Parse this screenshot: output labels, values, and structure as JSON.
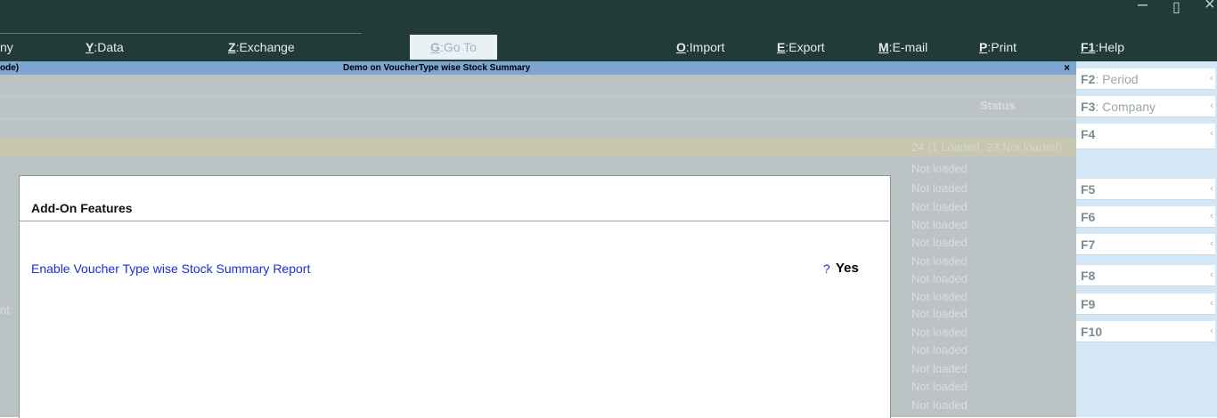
{
  "menu": {
    "items": [
      {
        "key": "",
        "label": "ny"
      },
      {
        "key": "Y",
        "label": "Data"
      },
      {
        "key": "Z",
        "label": "Exchange"
      },
      {
        "key": "G",
        "label": "Go To"
      },
      {
        "key": "O",
        "label": "Import"
      },
      {
        "key": "E",
        "label": "Export"
      },
      {
        "key": "M",
        "label": "E-mail"
      },
      {
        "key": "P",
        "label": "Print"
      },
      {
        "key": "F1",
        "label": "Help"
      }
    ]
  },
  "window": {
    "minimize": "–",
    "restore": "▯",
    "close": "×"
  },
  "titlebar": {
    "left_text": "ode)",
    "title": "Demo on VoucherType wise Stock Summary",
    "close": "×"
  },
  "background": {
    "status_header": "Status",
    "count_text": "24 (1 Loaded, 23 Not loaded)",
    "row_status": "Not loaded",
    "fragment": "nt"
  },
  "side_buttons": [
    {
      "key": "F2",
      "label": "Period"
    },
    {
      "key": "F3",
      "label": "Company"
    },
    {
      "key": "F4",
      "label": ""
    },
    {
      "key": "F5",
      "label": ""
    },
    {
      "key": "F6",
      "label": ""
    },
    {
      "key": "F7",
      "label": ""
    },
    {
      "key": "F8",
      "label": ""
    },
    {
      "key": "F9",
      "label": ""
    },
    {
      "key": "F10",
      "label": ""
    }
  ],
  "side_chevron": "‹",
  "dialog": {
    "title": "Add-On Features",
    "option_label": "Enable Voucher Type wise Stock Summary Report",
    "option_prompt": "?",
    "option_value": "Yes"
  }
}
